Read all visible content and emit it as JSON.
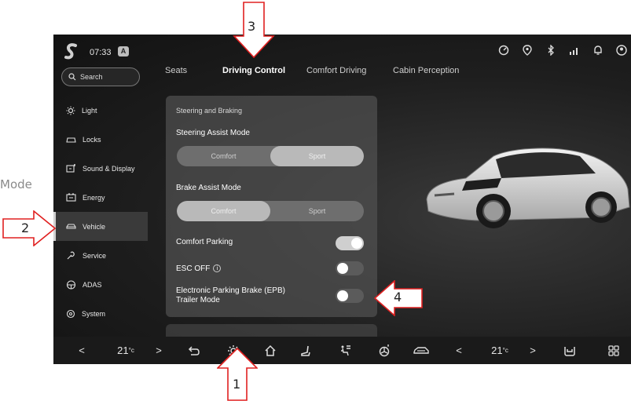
{
  "side_caption": "Mode",
  "status": {
    "time": "07:33",
    "badge": "A"
  },
  "search": {
    "placeholder": "Search"
  },
  "sidebar": {
    "items": [
      {
        "label": "Light"
      },
      {
        "label": "Locks"
      },
      {
        "label": "Sound & Display"
      },
      {
        "label": "Energy"
      },
      {
        "label": "Vehicle",
        "active": true
      },
      {
        "label": "Service"
      },
      {
        "label": "ADAS"
      },
      {
        "label": "System"
      }
    ]
  },
  "tabs": [
    {
      "label": "Seats"
    },
    {
      "label": "Driving Control",
      "active": true
    },
    {
      "label": "Comfort Driving"
    },
    {
      "label": "Cabin Perception"
    }
  ],
  "panel": {
    "section_title": "Steering and Braking",
    "steering_assist": {
      "label": "Steering Assist Mode",
      "options": [
        "Comfort",
        "Sport"
      ],
      "selected": "Sport"
    },
    "brake_assist": {
      "label": "Brake Assist Mode",
      "options": [
        "Comfort",
        "Sport"
      ],
      "selected": "Comfort"
    },
    "comfort_parking": {
      "label": "Comfort Parking",
      "on": true
    },
    "esc_off": {
      "label": "ESC OFF",
      "on": false,
      "info_icon": "i"
    },
    "epb_trailer": {
      "label_line1": "Electronic Parking Brake (EPB)",
      "label_line2": "Trailer Mode",
      "on": false
    }
  },
  "bottombar": {
    "left_prev": "<",
    "left_temp": "21",
    "left_unit": "°c",
    "left_next": ">",
    "right_prev": "<",
    "right_temp": "21",
    "right_unit": "°c",
    "right_next": ">"
  },
  "callouts": [
    "1",
    "2",
    "3",
    "4"
  ],
  "icons": [
    "s-logo-icon",
    "search-icon",
    "light-icon",
    "lock-icon",
    "sound-display-icon",
    "energy-icon",
    "car-icon",
    "service-icon",
    "adas-icon",
    "system-icon",
    "back-icon",
    "settings-icon",
    "home-icon",
    "seat-icon",
    "ac-mode-icon",
    "fan-icon",
    "car-air-icon",
    "grid-icon",
    "bell-icon",
    "bluetooth-icon",
    "signal-icon",
    "location-icon",
    "speedometer-icon",
    "user-icon"
  ]
}
